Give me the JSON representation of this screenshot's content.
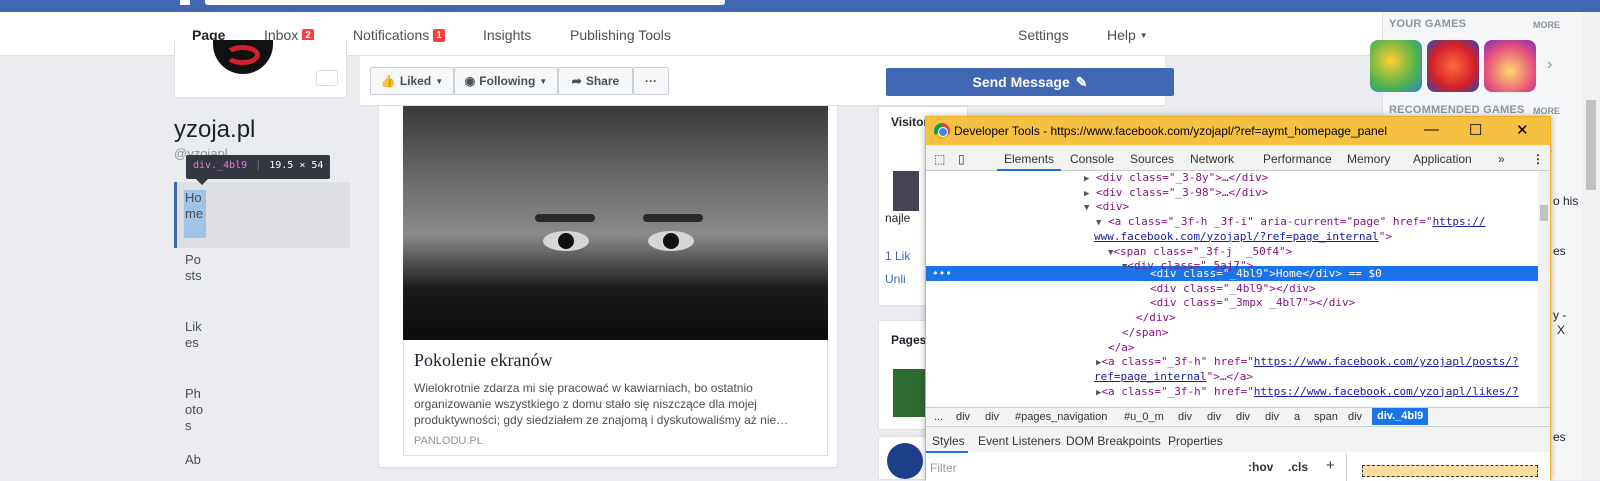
{
  "tabs": [
    {
      "label": "Page",
      "active": true
    },
    {
      "label": "Inbox",
      "badge": "2"
    },
    {
      "label": "Notifications",
      "badge": "1"
    },
    {
      "label": "Insights"
    },
    {
      "label": "Publishing Tools"
    },
    {
      "label": "Settings"
    },
    {
      "label": "Help"
    }
  ],
  "right_sidebar": {
    "your_games": "YOUR GAMES",
    "more": "MORE",
    "recommended": "RECOMMENDED GAMES",
    "more2": "MORE",
    "peek": [
      "o his",
      "es",
      "y -",
      "X",
      "es"
    ]
  },
  "profile": {
    "name": "yzoja.pl",
    "username": "@yzojapl"
  },
  "tooltip": {
    "selector": "div._4bl9",
    "size": "19.5 × 54"
  },
  "left_nav": [
    "Home",
    "Posts",
    "Likes",
    "Photos",
    "Ab"
  ],
  "action_bar": {
    "liked": "Liked",
    "following": "Following",
    "share": "Share",
    "more": "···",
    "send": "Send Message"
  },
  "post": {
    "title": "Pokolenie ekranów",
    "description": "Wielokrotnie zdarza mi się pracować w kawiarniach, bo ostatnio organizowanie wszystkiego z domu stało się niszczące dla mojej produktywności; gdy siedziałem ze znajomą i dyskutowaliśmy aż nie…",
    "source": "PANLODU.PL"
  },
  "side_widgets": {
    "visitor": "Visitor",
    "najle": "najle",
    "likes": "1 Lik",
    "unlike": "Unli",
    "pages": "Pages l"
  },
  "devtools": {
    "title": "Developer Tools - https://www.facebook.com/yzojapl/?ref=aymt_homepage_panel",
    "tabs": [
      "Elements",
      "Console",
      "Sources",
      "Network",
      "Performance",
      "Memory",
      "Application",
      "»"
    ],
    "breadcrumbs": [
      "...",
      "div",
      "div",
      "#pages_navigation",
      "#u_0_m",
      "div",
      "div",
      "div",
      "div",
      "a",
      "span",
      "div",
      "div._4bl9"
    ],
    "subtabs": [
      "Styles",
      "Event Listeners",
      "DOM Breakpoints",
      "Properties"
    ],
    "filter_placeholder": "Filter",
    "hov": ":hov",
    "cls": ".cls",
    "plus": "+",
    "code": {
      "l1": "<div class=\"_3-8y\">…</div>",
      "l2": "<div class=\"_3-98\">…</div>",
      "l3": "<div>",
      "l4a": "<a class=\"_3f-h _3f-i\" aria-current=\"page\" href=\"",
      "l4b": "https://",
      "l5": "www.facebook.com/yzojapl/?ref=page_internal",
      "l6": "<span class=\"_3f-j  _50f4\">",
      "l7": "<div class=\"_5aj7\">",
      "l8": "<div class=\"_4bl9\">Home</div> == $0",
      "l9": "<div class=\"_4bl9\"></div>",
      "l10": "<div class=\"_3mpx _4bl7\"></div>",
      "l11": "</div>",
      "l12": "</span>",
      "l13": "</a>",
      "l14a": "<a class=\"_3f-h\" href=\"",
      "l14b": "https://www.facebook.com/yzojapl/posts/?",
      "l15": "ref=page_internal",
      "l15b": "\">…</a>",
      "l16a": "<a class=\"_3f-h\" href=\"",
      "l16b": "https://www.facebook.com/yzojapl/likes/?"
    }
  }
}
